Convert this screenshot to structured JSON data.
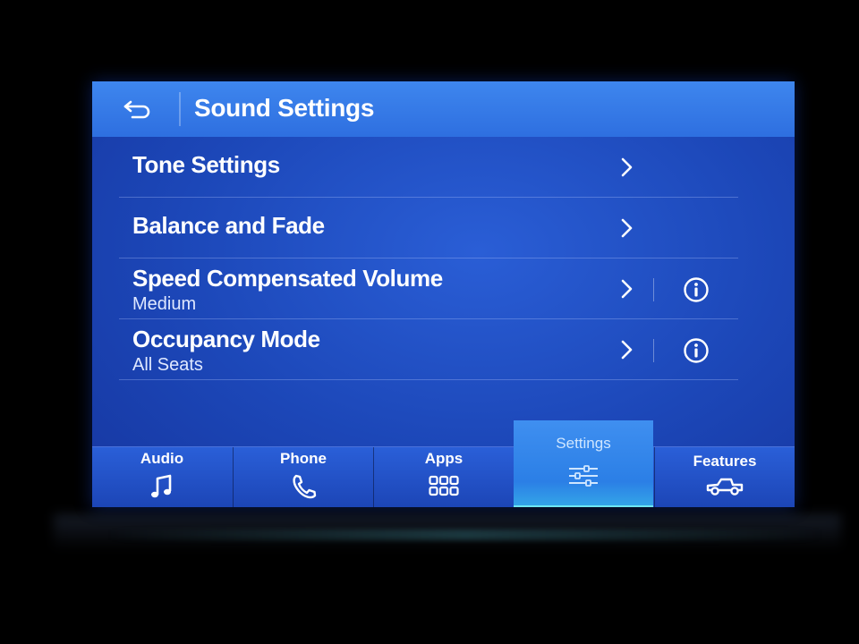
{
  "header": {
    "title": "Sound Settings",
    "back_icon": "back-arrow-icon"
  },
  "menu": {
    "items": [
      {
        "label": "Tone Settings",
        "sub": "",
        "chevron_icon": "chevron-right-icon"
      },
      {
        "label": "Balance and Fade",
        "sub": "",
        "chevron_icon": "chevron-right-icon"
      },
      {
        "label": "Speed Compensated Volume",
        "sub": "Medium",
        "chevron_icon": "chevron-right-icon",
        "info_icon": "info-icon"
      },
      {
        "label": "Occupancy Mode",
        "sub": "All Seats",
        "chevron_icon": "chevron-right-icon",
        "info_icon": "info-icon"
      }
    ]
  },
  "nav": {
    "items": [
      {
        "label": "Audio",
        "icon": "music-note-icon"
      },
      {
        "label": "Phone",
        "icon": "phone-icon"
      },
      {
        "label": "Apps",
        "icon": "apps-grid-icon"
      },
      {
        "label": "Settings",
        "icon": "sliders-icon",
        "active": true
      },
      {
        "label": "Features",
        "icon": "truck-icon"
      }
    ]
  },
  "colors": {
    "screen_background": "#1c47b8",
    "header_background": "#3e86ee",
    "active_tab": "#2b7fe6",
    "active_tab_underline": "#6ee6f2",
    "text": "#ffffff"
  }
}
